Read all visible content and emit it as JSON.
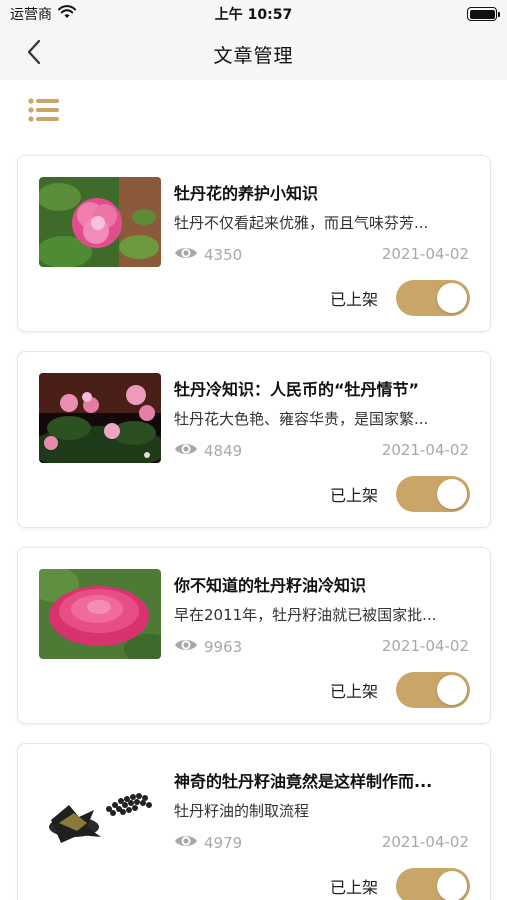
{
  "status_bar": {
    "carrier": "运营商",
    "time": "上午 10:57"
  },
  "nav": {
    "title": "文章管理"
  },
  "colors": {
    "accent": "#c9a567",
    "meta_gray": "#a8a8a8"
  },
  "icons": {
    "back": "chevron-left-icon",
    "menu": "list-icon",
    "views": "eye-icon",
    "wifi": "wifi-icon",
    "battery": "battery-icon"
  },
  "articles": [
    {
      "title": "牡丹花的养护小知识",
      "summary": "牡丹不仅看起来优雅，而且气味芬芳...",
      "views": "4350",
      "date": "2021-04-02",
      "status_label": "已上架",
      "published": true
    },
    {
      "title": "牡丹冷知识：人民币的“牡丹情节”",
      "summary": "牡丹花大色艳、雍容华贵，是国家繁...",
      "views": "4849",
      "date": "2021-04-02",
      "status_label": "已上架",
      "published": true
    },
    {
      "title": "你不知道的牡丹籽油冷知识",
      "summary": "早在2011年，牡丹籽油就已被国家批...",
      "views": "9963",
      "date": "2021-04-02",
      "status_label": "已上架",
      "published": true
    },
    {
      "title": "神奇的牡丹籽油竟然是这样制作而...",
      "summary": "牡丹籽油的制取流程",
      "views": "4979",
      "date": "2021-04-02",
      "status_label": "已上架",
      "published": true
    }
  ]
}
